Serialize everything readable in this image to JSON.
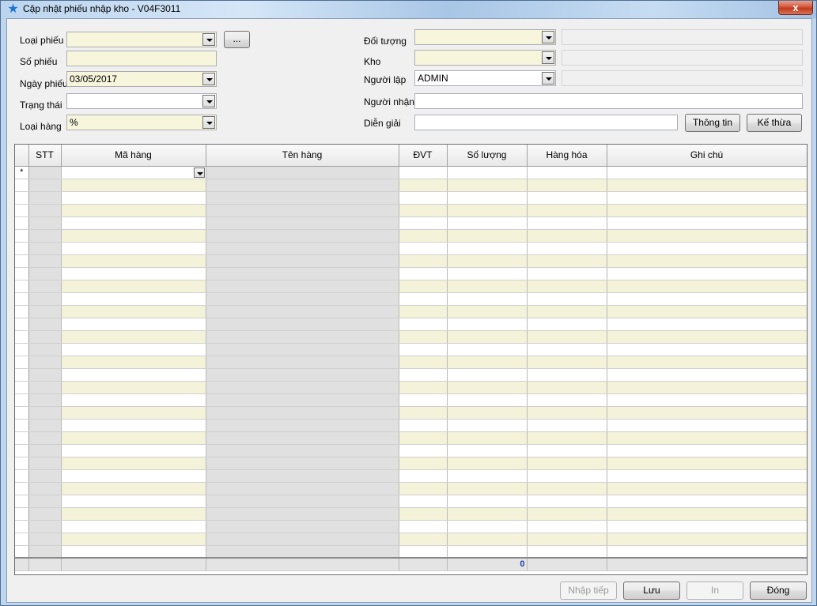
{
  "window": {
    "title": "Cập nhật phiếu nhập kho - V04F3011",
    "title_icon": "star-icon",
    "close_label": "x"
  },
  "form": {
    "loai_phieu": {
      "label": "Loại phiếu",
      "value": ""
    },
    "browse_label": "...",
    "so_phieu": {
      "label": "Số phiếu",
      "value": ""
    },
    "ngay_phieu": {
      "label": "Ngày phiếu",
      "value": "03/05/2017"
    },
    "trang_thai": {
      "label": "Trạng thái",
      "value": ""
    },
    "loai_hang": {
      "label": "Loại hàng",
      "value": "%"
    },
    "doi_tuong": {
      "label": "Đối tượng",
      "value": "",
      "detail": ""
    },
    "kho": {
      "label": "Kho",
      "value": "",
      "detail": ""
    },
    "nguoi_lap": {
      "label": "Người lập",
      "value": "ADMIN",
      "detail": ""
    },
    "nguoi_nhan": {
      "label": "Người nhận",
      "value": ""
    },
    "dien_giai": {
      "label": "Diễn giải",
      "value": ""
    },
    "thong_tin_label": "Thông tin",
    "ke_thua_label": "Kế thừa"
  },
  "grid": {
    "columns": [
      "STT",
      "Mã hàng",
      "Tên hàng",
      "ĐVT",
      "Số lượng",
      "Hàng hóa",
      "Ghi chú"
    ],
    "new_row_marker": "*",
    "total_quantity": "0"
  },
  "buttons": {
    "nhap_tiep": "Nhập tiếp",
    "luu": "Lưu",
    "in": "In",
    "dong": "Đóng"
  },
  "colors": {
    "input_yellow": "#f7f5dc",
    "row_alt": "#f4f2d8",
    "readonly_col": "#e0e0e0",
    "total_text": "#1b3fb5"
  }
}
